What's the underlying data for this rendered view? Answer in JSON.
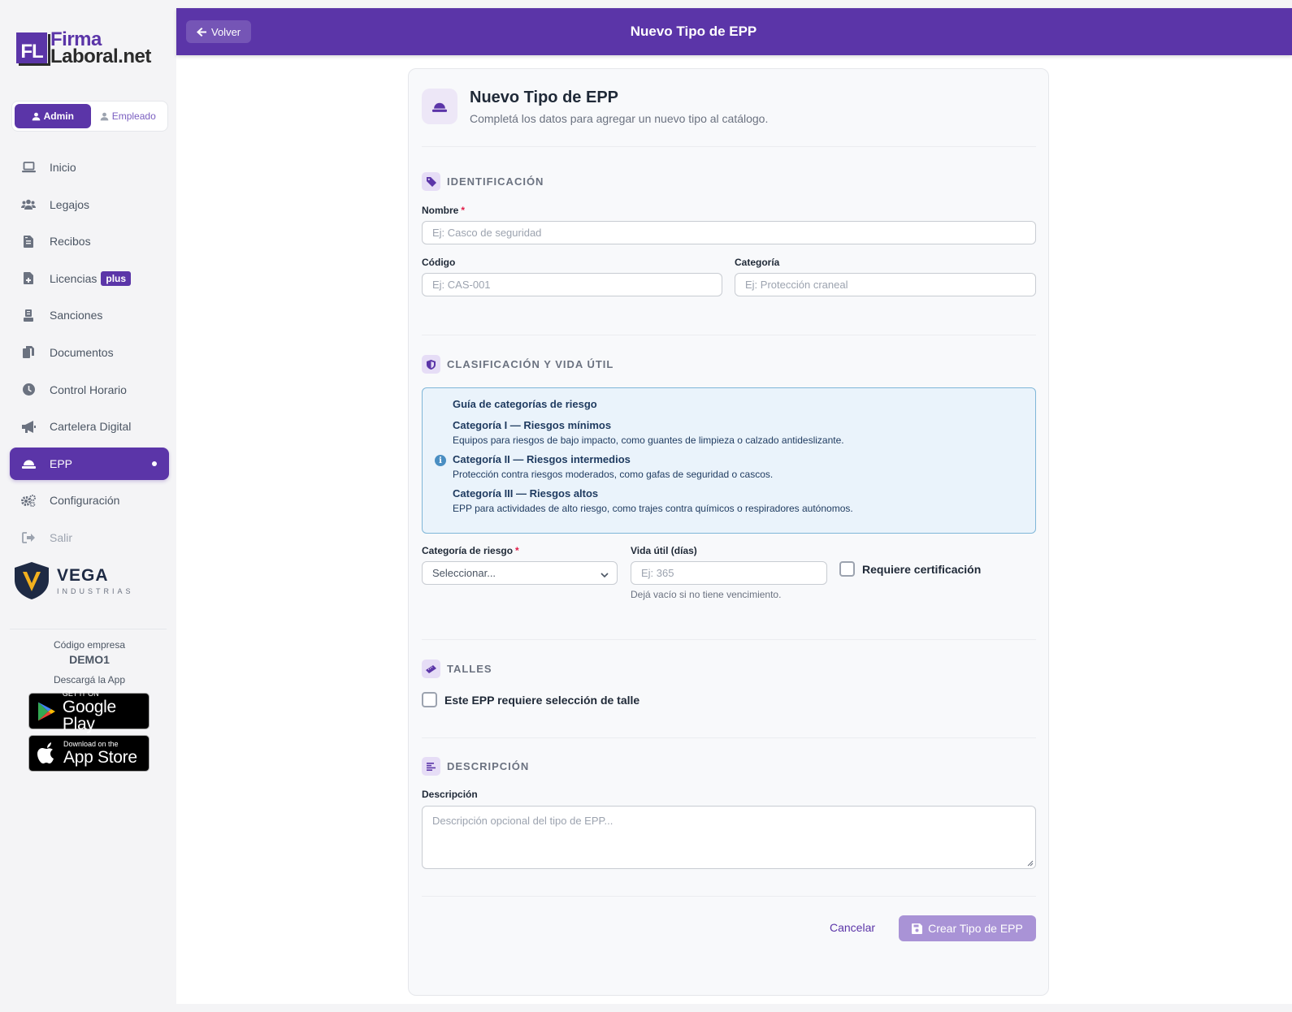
{
  "brand": {
    "logo_mark": "FL",
    "logo_line1": "Firma",
    "logo_line2": "Laboral.net",
    "color": "#5b35a8"
  },
  "role_toggle": {
    "admin_label": "Admin",
    "employee_label": "Empleado",
    "selected": "Admin"
  },
  "sidebar": {
    "items": [
      {
        "label": "Inicio",
        "icon": "laptop-icon"
      },
      {
        "label": "Legajos",
        "icon": "users-icon"
      },
      {
        "label": "Recibos",
        "icon": "invoice-icon"
      },
      {
        "label": "Licencias",
        "icon": "file-medical-icon",
        "badge": "plus"
      },
      {
        "label": "Sanciones",
        "icon": "gavel-icon"
      },
      {
        "label": "Documentos",
        "icon": "copy-icon"
      },
      {
        "label": "Control Horario",
        "icon": "clock-icon"
      },
      {
        "label": "Cartelera Digital",
        "icon": "megaphone-icon"
      },
      {
        "label": "EPP",
        "icon": "hard-hat-icon",
        "active": true
      },
      {
        "label": "Configuración",
        "icon": "cogs-icon"
      },
      {
        "label": "Salir",
        "icon": "sign-out-icon"
      }
    ]
  },
  "company_logo": {
    "name": "VEGA",
    "subtitle": "INDUSTRIAS"
  },
  "company": {
    "code_label": "Código empresa",
    "code": "DEMO1",
    "download_label": "Descargá la App"
  },
  "stores": {
    "google": {
      "line1": "GET IT ON",
      "line2": "Google Play"
    },
    "apple": {
      "line1": "Download on the",
      "line2": "App Store"
    }
  },
  "topbar": {
    "back_label": "Volver",
    "title": "Nuevo Tipo de EPP"
  },
  "form": {
    "title": "Nuevo Tipo de EPP",
    "subtitle": "Completá los datos para agregar un nuevo tipo al catálogo.",
    "sections": {
      "identificacion": "IDENTIFICACIÓN",
      "clasificacion": "CLASIFICACIÓN Y VIDA ÚTIL",
      "talles": "TALLES",
      "descripcion": "DESCRIPCIÓN"
    },
    "nombre": {
      "label": "Nombre",
      "placeholder": "Ej: Casco de seguridad",
      "value": ""
    },
    "codigo": {
      "label": "Código",
      "placeholder": "Ej: CAS-001",
      "value": ""
    },
    "categoria": {
      "label": "Categoría",
      "placeholder": "Ej: Protección craneal",
      "value": ""
    },
    "guide": {
      "title": "Guía de categorías de riesgo",
      "items": [
        {
          "title": "Categoría I — Riesgos mínimos",
          "desc": "Equipos para riesgos de bajo impacto, como guantes de limpieza o calzado antideslizante."
        },
        {
          "title": "Categoría II — Riesgos intermedios",
          "desc": "Protección contra riesgos moderados, como gafas de seguridad o cascos."
        },
        {
          "title": "Categoría III — Riesgos altos",
          "desc": "EPP para actividades de alto riesgo, como trajes contra químicos o respiradores autónomos."
        }
      ]
    },
    "categoria_riesgo": {
      "label": "Categoría de riesgo",
      "selected": "Seleccionar..."
    },
    "vida_util": {
      "label": "Vida útil (días)",
      "placeholder": "Ej: 365",
      "help": "Dejá vacío si no tiene vencimiento.",
      "value": ""
    },
    "requiere_certificacion": {
      "label": "Requiere certificación",
      "checked": false
    },
    "requiere_talle": {
      "label": "Este EPP requiere selección de talle",
      "checked": false
    },
    "descripcion": {
      "label": "Descripción",
      "placeholder": "Descripción opcional del tipo de EPP...",
      "value": ""
    },
    "actions": {
      "cancel": "Cancelar",
      "submit": "Crear Tipo de EPP"
    }
  }
}
